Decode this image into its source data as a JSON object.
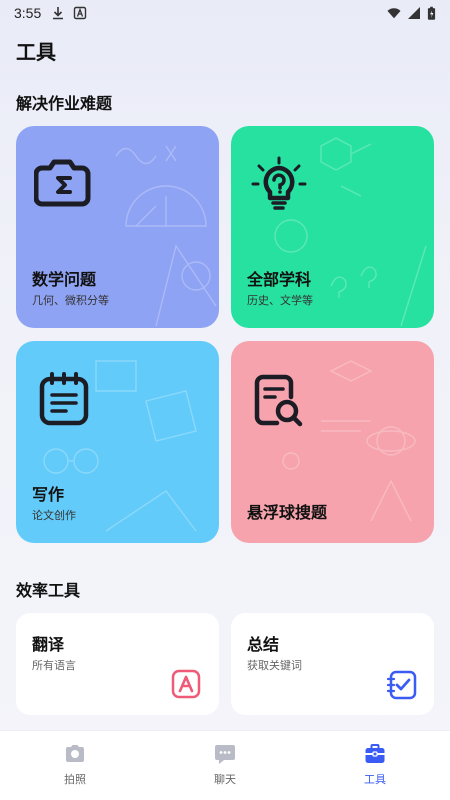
{
  "status_bar": {
    "time": "3:55",
    "left_icons": [
      "download-icon",
      "app-notification-icon"
    ],
    "right_icons": [
      "wifi-icon",
      "signal-icon",
      "battery-icon"
    ]
  },
  "page": {
    "title": "工具"
  },
  "homework_section": {
    "title": "解决作业难题",
    "cards": [
      {
        "title": "数学问题",
        "subtitle": "几何、微积分等",
        "icon": "sigma-camera-icon",
        "color": "#8fa3f4"
      },
      {
        "title": "全部学科",
        "subtitle": "历史、文学等",
        "icon": "lightbulb-question-icon",
        "color": "#27e1a1"
      },
      {
        "title": "写作",
        "subtitle": "论文创作",
        "icon": "notepad-icon",
        "color": "#63cbf9"
      },
      {
        "title": "悬浮球搜题",
        "subtitle": "",
        "icon": "search-document-icon",
        "color": "#f6a3ad"
      }
    ]
  },
  "efficiency_section": {
    "title": "效率工具",
    "cards": [
      {
        "title": "翻译",
        "subtitle": "所有语言",
        "icon": "translate-a-icon",
        "color": "#ee5a78"
      },
      {
        "title": "总结",
        "subtitle": "获取关键词",
        "icon": "summary-check-icon",
        "color": "#3a5bf4"
      }
    ]
  },
  "bottom_nav": {
    "items": [
      {
        "label": "拍照",
        "icon": "camera-icon",
        "active": false
      },
      {
        "label": "聊天",
        "icon": "chat-icon",
        "active": false
      },
      {
        "label": "工具",
        "icon": "toolbox-icon",
        "active": true
      }
    ],
    "active_color": "#3a5bf4",
    "inactive_color": "#b9bcc6"
  }
}
